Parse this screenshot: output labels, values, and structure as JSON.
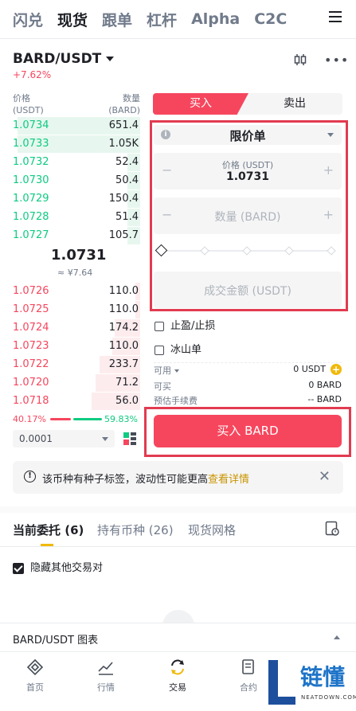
{
  "top_tabs": [
    "闪兑",
    "现货",
    "跟单",
    "杠杆",
    "Alpha",
    "C2C"
  ],
  "pair": {
    "symbol": "BARD/USDT",
    "change": "+7.62%"
  },
  "orderbook": {
    "price_label": "价格",
    "price_unit": "(USDT)",
    "qty_label": "数量",
    "qty_unit": "(BARD)",
    "asks": [
      {
        "price": "1.0734",
        "qty": "651.4",
        "depth": 0.96
      },
      {
        "price": "1.0733",
        "qty": "1.05K",
        "depth": 0.96
      },
      {
        "price": "1.0732",
        "qty": "52.4",
        "depth": 0.1
      },
      {
        "price": "1.0730",
        "qty": "50.4",
        "depth": 0.1
      },
      {
        "price": "1.0729",
        "qty": "150.4",
        "depth": 0.1
      },
      {
        "price": "1.0728",
        "qty": "51.4",
        "depth": 0.1
      },
      {
        "price": "1.0727",
        "qty": "105.7",
        "depth": 0.1
      }
    ],
    "mid_price": "1.0731",
    "mid_cny": "≈ ¥7.64",
    "bids": [
      {
        "price": "1.0726",
        "qty": "110.0",
        "depth": 0.04
      },
      {
        "price": "1.0725",
        "qty": "110.0",
        "depth": 0.04
      },
      {
        "price": "1.0724",
        "qty": "174.2",
        "depth": 0.2
      },
      {
        "price": "1.0723",
        "qty": "110.0",
        "depth": 0.22
      },
      {
        "price": "1.0722",
        "qty": "233.7",
        "depth": 0.32
      },
      {
        "price": "1.0720",
        "qty": "71.2",
        "depth": 0.35
      },
      {
        "price": "1.0718",
        "qty": "56.0",
        "depth": 0.38
      }
    ],
    "ratio_buy": "40.17%",
    "ratio_sell": "59.83%",
    "precision": "0.0001"
  },
  "trade": {
    "buy_tab": "买入",
    "sell_tab": "卖出",
    "order_type": "限价单",
    "price_label": "价格 (USDT)",
    "price_value": "1.0731",
    "qty_placeholder": "数量 (BARD)",
    "total_placeholder": "成交金额 (USDT)",
    "tp_sl_label": "止盈/止损",
    "iceberg_label": "冰山单",
    "available_label": "可用",
    "available_value": "0 USDT",
    "can_buy_label": "可买",
    "can_buy_value": "0 BARD",
    "fee_label": "预估手续费",
    "fee_value": "-- BARD",
    "buy_button": "买入 BARD"
  },
  "notice": {
    "text": "该币种有种子标签，波动性可能更高",
    "link": "查看详情"
  },
  "order_tabs": [
    "当前委托 (6)",
    "持有币种 (26)",
    "现货网格"
  ],
  "hide_pairs_label": "隐藏其他交易对",
  "chart_bar_label": "BARD/USDT 图表",
  "bottom_nav": [
    "首页",
    "行情",
    "交易",
    "合约"
  ],
  "watermark": {
    "text": "链懂",
    "sub": "NEATDOWN.COM"
  }
}
